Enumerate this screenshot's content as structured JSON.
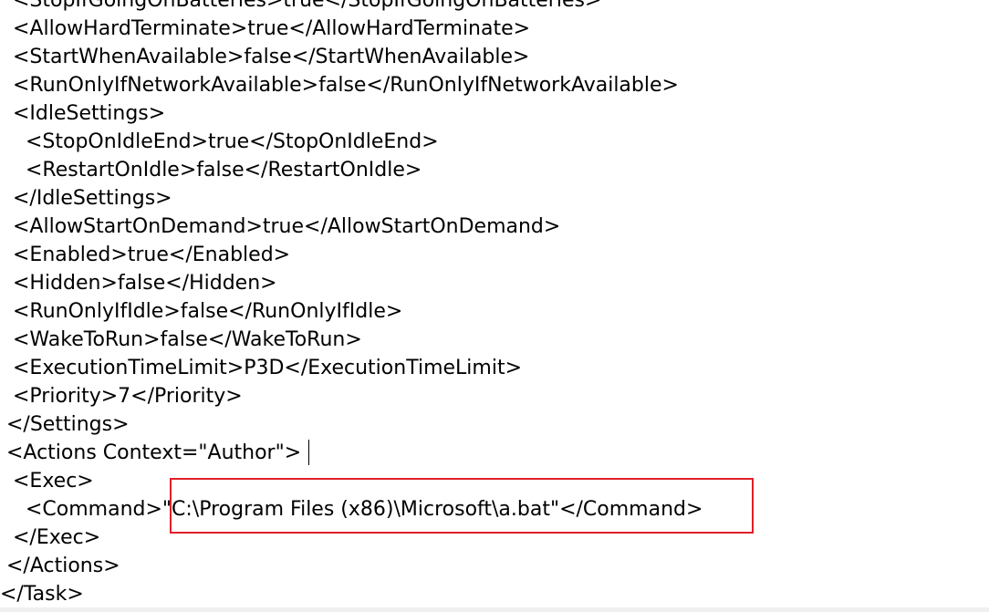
{
  "editor": {
    "lines": [
      "  <StopIfGoingOnBatteries>true</StopIfGoingOnBatteries>",
      "  <AllowHardTerminate>true</AllowHardTerminate>",
      "  <StartWhenAvailable>false</StartWhenAvailable>",
      "  <RunOnlyIfNetworkAvailable>false</RunOnlyIfNetworkAvailable>",
      "  <IdleSettings>",
      "    <StopOnIdleEnd>true</StopOnIdleEnd>",
      "    <RestartOnIdle>false</RestartOnIdle>",
      "  </IdleSettings>",
      "  <AllowStartOnDemand>true</AllowStartOnDemand>",
      "  <Enabled>true</Enabled>",
      "  <Hidden>false</Hidden>",
      "  <RunOnlyIfIdle>false</RunOnlyIfIdle>",
      "  <WakeToRun>false</WakeToRun>",
      "  <ExecutionTimeLimit>P3D</ExecutionTimeLimit>",
      "  <Priority>7</Priority>",
      " </Settings>",
      " <Actions Context=\"Author\">",
      "  <Exec>",
      "    <Command>\"C:\\Program Files (x86)\\Microsoft\\a.bat\"</Command>",
      "  </Exec>",
      " </Actions>",
      "</Task>"
    ]
  },
  "colors": {
    "highlight_border": "#e0202a",
    "text": "#000000",
    "background": "#ffffff"
  }
}
